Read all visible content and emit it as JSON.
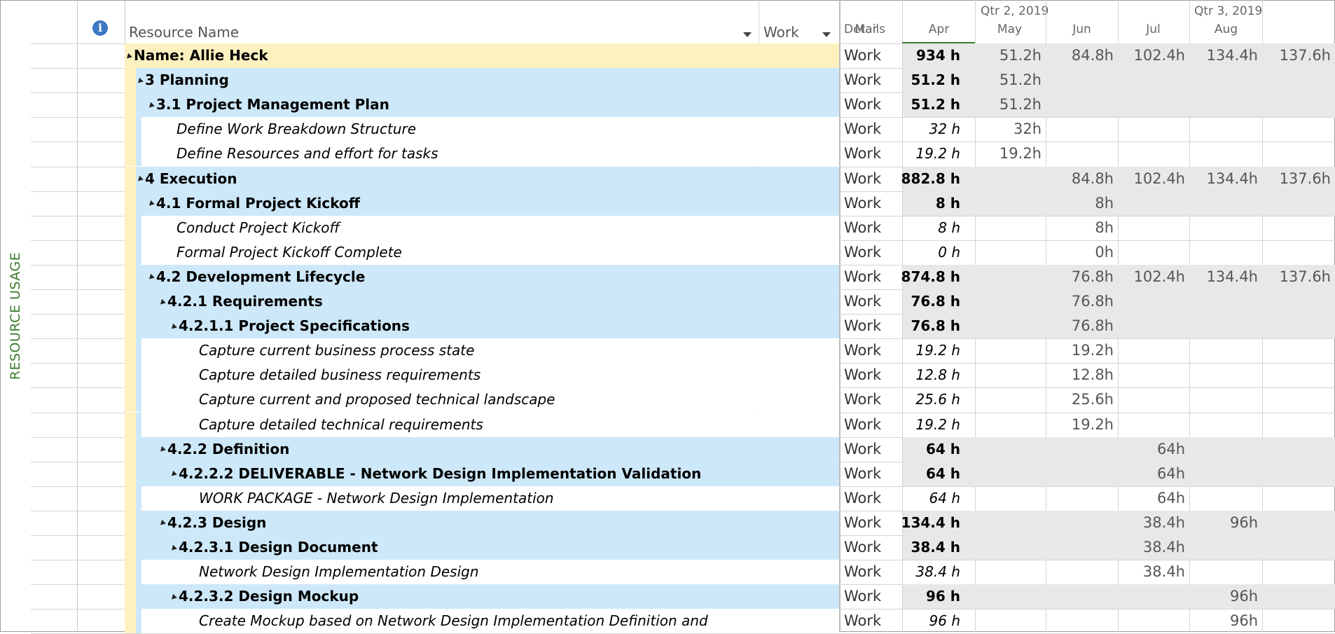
{
  "view_label": "RESOURCE USAGE",
  "columns": {
    "resource_name": "Resource Name",
    "work": "Work",
    "details": "Details"
  },
  "timescale": {
    "quarters": [
      "Qtr 2, 2019",
      "Qtr 3, 2019"
    ],
    "months": [
      "Mar",
      "Apr",
      "May",
      "Jun",
      "Jul",
      "Aug"
    ]
  },
  "rows": [
    {
      "name": "Name: Allie Heck",
      "work": "934 h",
      "kind": "resource",
      "level": 0,
      "detail": "Work",
      "values": [
        "",
        "51.2h",
        "84.8h",
        "102.4h",
        "134.4h",
        "137.6h"
      ]
    },
    {
      "name": "3  Planning",
      "work": "51.2 h",
      "kind": "summary",
      "level": 1,
      "detail": "Work",
      "values": [
        "",
        "51.2h",
        "",
        "",
        "",
        ""
      ]
    },
    {
      "name": "3.1  Project Management Plan",
      "work": "51.2 h",
      "kind": "summary",
      "level": 2,
      "detail": "Work",
      "values": [
        "",
        "51.2h",
        "",
        "",
        "",
        ""
      ]
    },
    {
      "name": "Define Work Breakdown Structure",
      "work": "32 h",
      "kind": "task",
      "level": 3,
      "detail": "Work",
      "values": [
        "",
        "32h",
        "",
        "",
        "",
        ""
      ]
    },
    {
      "name": "Define Resources and effort for tasks",
      "work": "19.2 h",
      "kind": "task",
      "level": 3,
      "detail": "Work",
      "values": [
        "",
        "19.2h",
        "",
        "",
        "",
        ""
      ]
    },
    {
      "name": "4  Execution",
      "work": "882.8 h",
      "kind": "summary",
      "level": 1,
      "detail": "Work",
      "values": [
        "",
        "",
        "84.8h",
        "102.4h",
        "134.4h",
        "137.6h"
      ]
    },
    {
      "name": "4.1  Formal Project Kickoff",
      "work": "8 h",
      "kind": "summary",
      "level": 2,
      "detail": "Work",
      "values": [
        "",
        "",
        "8h",
        "",
        "",
        ""
      ]
    },
    {
      "name": "Conduct Project Kickoff",
      "work": "8 h",
      "kind": "task",
      "level": 3,
      "detail": "Work",
      "values": [
        "",
        "",
        "8h",
        "",
        "",
        ""
      ]
    },
    {
      "name": "Formal Project Kickoff Complete",
      "work": "0 h",
      "kind": "task",
      "level": 3,
      "detail": "Work",
      "values": [
        "",
        "",
        "0h",
        "",
        "",
        ""
      ]
    },
    {
      "name": "4.2  Development Lifecycle",
      "work": "874.8 h",
      "kind": "summary",
      "level": 2,
      "detail": "Work",
      "values": [
        "",
        "",
        "76.8h",
        "102.4h",
        "134.4h",
        "137.6h"
      ]
    },
    {
      "name": "4.2.1  Requirements",
      "work": "76.8 h",
      "kind": "summary",
      "level": 3,
      "detail": "Work",
      "values": [
        "",
        "",
        "76.8h",
        "",
        "",
        ""
      ]
    },
    {
      "name": "4.2.1.1  Project Specifications",
      "work": "76.8 h",
      "kind": "summary",
      "level": 4,
      "detail": "Work",
      "values": [
        "",
        "",
        "76.8h",
        "",
        "",
        ""
      ]
    },
    {
      "name": "Capture current business process state",
      "work": "19.2 h",
      "kind": "task",
      "level": 5,
      "detail": "Work",
      "values": [
        "",
        "",
        "19.2h",
        "",
        "",
        ""
      ]
    },
    {
      "name": "Capture detailed business requirements",
      "work": "12.8 h",
      "kind": "task",
      "level": 5,
      "detail": "Work",
      "values": [
        "",
        "",
        "12.8h",
        "",
        "",
        ""
      ]
    },
    {
      "name": "Capture current and proposed technical landscape",
      "work": "25.6 h",
      "kind": "task",
      "level": 5,
      "detail": "Work",
      "values": [
        "",
        "",
        "25.6h",
        "",
        "",
        ""
      ]
    },
    {
      "name": "Capture detailed technical requirements",
      "work": "19.2 h",
      "kind": "task",
      "level": 5,
      "detail": "Work",
      "values": [
        "",
        "",
        "19.2h",
        "",
        "",
        ""
      ]
    },
    {
      "name": "4.2.2  Definition",
      "work": "64 h",
      "kind": "summary",
      "level": 3,
      "detail": "Work",
      "values": [
        "",
        "",
        "",
        "64h",
        "",
        ""
      ]
    },
    {
      "name": "4.2.2.2  DELIVERABLE - Network Design Implementation Validation",
      "work": "64 h",
      "kind": "summary",
      "level": 4,
      "detail": "Work",
      "values": [
        "",
        "",
        "",
        "64h",
        "",
        ""
      ]
    },
    {
      "name": "WORK PACKAGE -  Network Design Implementation",
      "work": "64 h",
      "kind": "task",
      "level": 5,
      "detail": "Work",
      "values": [
        "",
        "",
        "",
        "64h",
        "",
        ""
      ]
    },
    {
      "name": "4.2.3  Design",
      "work": "134.4 h",
      "kind": "summary",
      "level": 3,
      "detail": "Work",
      "values": [
        "",
        "",
        "",
        "38.4h",
        "96h",
        ""
      ]
    },
    {
      "name": "4.2.3.1  Design Document",
      "work": "38.4 h",
      "kind": "summary",
      "level": 4,
      "detail": "Work",
      "values": [
        "",
        "",
        "",
        "38.4h",
        "",
        ""
      ]
    },
    {
      "name": "Network Design Implementation Design",
      "work": "38.4 h",
      "kind": "task",
      "level": 5,
      "detail": "Work",
      "values": [
        "",
        "",
        "",
        "38.4h",
        "",
        ""
      ]
    },
    {
      "name": "4.2.3.2  Design Mockup",
      "work": "96 h",
      "kind": "summary",
      "level": 4,
      "detail": "Work",
      "values": [
        "",
        "",
        "",
        "",
        "96h",
        ""
      ]
    },
    {
      "name": "Create Mockup based on Network Design Implementation Definition and",
      "work": "96 h",
      "kind": "task",
      "level": 5,
      "detail": "Work",
      "values": [
        "",
        "",
        "",
        "",
        "96h",
        ""
      ]
    }
  ],
  "colors": {
    "resource_row": "#fdf1c0",
    "summary_row": "#cde8f8",
    "timephased_shade": "#e8e8e8",
    "view_label": "#3a7d2c",
    "info_icon": "#3e78c2"
  }
}
